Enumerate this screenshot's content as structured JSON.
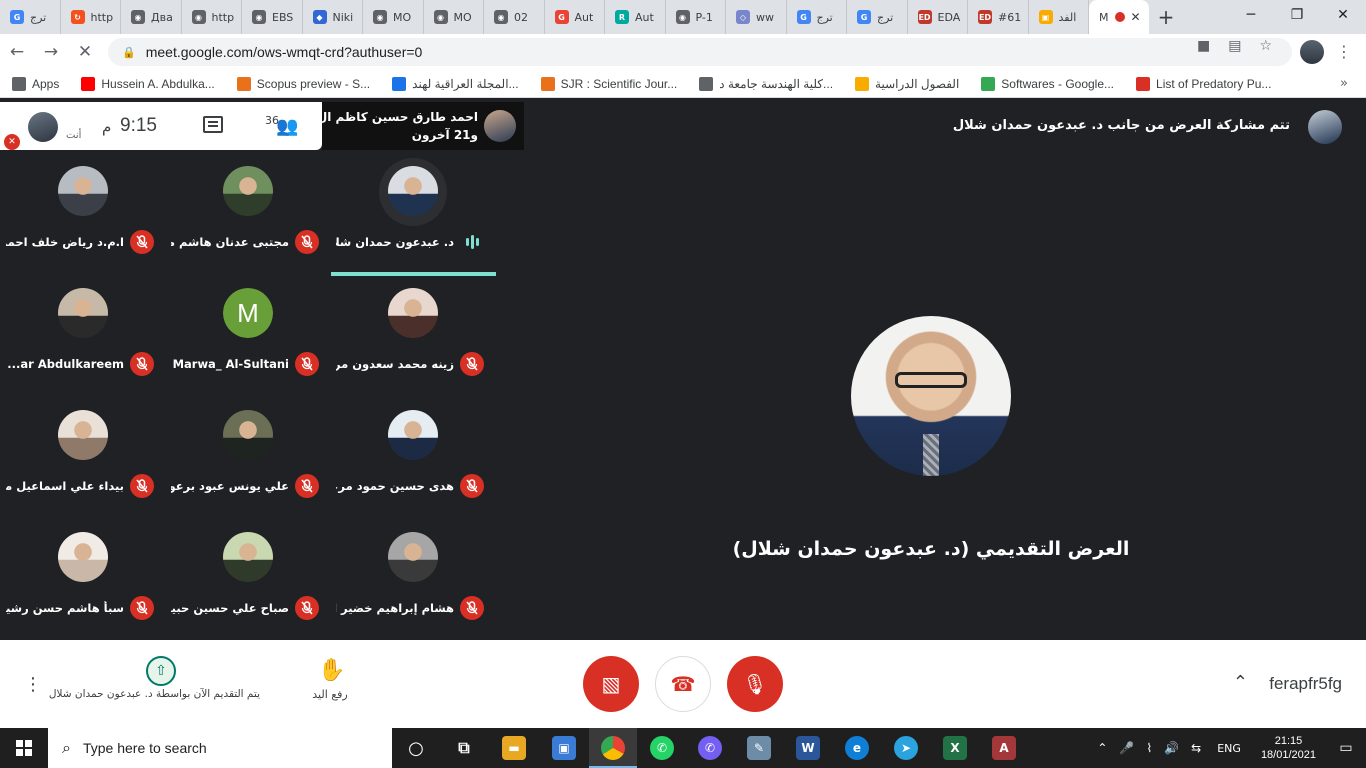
{
  "tabs": [
    {
      "label": "ترج",
      "color": "#4285f4",
      "glyph": "G"
    },
    {
      "label": "http",
      "color": "#f4511e",
      "glyph": "↻"
    },
    {
      "label": "Два",
      "color": "#5f6368",
      "glyph": "◉"
    },
    {
      "label": "http",
      "color": "#5f6368",
      "glyph": "◉"
    },
    {
      "label": "EBS",
      "color": "#5f6368",
      "glyph": "◉"
    },
    {
      "label": "Niki",
      "color": "#3367d6",
      "glyph": "◆"
    },
    {
      "label": "MO",
      "color": "#5f6368",
      "glyph": "◉"
    },
    {
      "label": "MO",
      "color": "#5f6368",
      "glyph": "◉"
    },
    {
      "label": "02",
      "color": "#5f6368",
      "glyph": "◉"
    },
    {
      "label": "Aut",
      "color": "#ea4335",
      "glyph": "G"
    },
    {
      "label": "Aut",
      "color": "#00a99d",
      "glyph": "R"
    },
    {
      "label": "P-1",
      "color": "#5f6368",
      "glyph": "◉"
    },
    {
      "label": "ww",
      "color": "#7986cb",
      "glyph": "◇"
    },
    {
      "label": "ترج",
      "color": "#4285f4",
      "glyph": "G"
    },
    {
      "label": "ترج",
      "color": "#4285f4",
      "glyph": "G"
    },
    {
      "label": "EDA",
      "color": "#c0392b",
      "glyph": "ED"
    },
    {
      "label": "#61",
      "color": "#c0392b",
      "glyph": "ED"
    },
    {
      "label": "الفد",
      "color": "#f9ab00",
      "glyph": "▣"
    }
  ],
  "active_tab": {
    "label": "M",
    "close": "✕"
  },
  "new_tab": "+",
  "window_controls": [
    "─",
    "❐",
    "✕"
  ],
  "address": {
    "url": "meet.google.com/ows-wmqt-crd?authuser=0"
  },
  "bookmarks": [
    {
      "label": "Apps",
      "color": "#5f6368"
    },
    {
      "label": "Hussein A. Abdulka...",
      "color": "#ff0000"
    },
    {
      "label": "Scopus preview - S...",
      "color": "#e9711c"
    },
    {
      "label": "المجلة العراقية لهند...",
      "color": "#1a73e8"
    },
    {
      "label": "SJR : Scientific Jour...",
      "color": "#e9711c"
    },
    {
      "label": "كلية الهندسة جامعة د...",
      "color": "#5f6368"
    },
    {
      "label": "الفصول الدراسية",
      "color": "#f9ab00"
    },
    {
      "label": "Softwares - Google...",
      "color": "#34a853"
    },
    {
      "label": "List of Predatory Pu...",
      "color": "#d93025"
    }
  ],
  "bookmarks_more": "»",
  "meet": {
    "self_label": "أنت",
    "clock_ampm": "م",
    "clock": "9:15",
    "participant_count": "36",
    "speaker_name": "احمد طارق حسين كاظم ال...",
    "speaker_others": "و21 آخرون",
    "presenter_banner": "تتم مشاركة العرض من جانب د. عبدعون حمدان شلال",
    "presentation_title": "العرض التقديمي (د. عبدعون حمدان شلال)"
  },
  "participants": [
    {
      "name": "د. عبدعون حمدان شلال",
      "speaking": true,
      "photo": [
        "#d9dde2",
        "#1f3350"
      ]
    },
    {
      "name": "مجتبى عدنان هاشم محم...",
      "speaking": false,
      "photo": [
        "#6f8f5e",
        "#2f3e2a"
      ]
    },
    {
      "name": "ا.م.د رياض خلف احمد ...",
      "speaking": false,
      "photo": [
        "#b7bcc2",
        "#3a3f48"
      ]
    },
    {
      "name": "زينه محمد سعدون مراد...",
      "speaking": false,
      "photo": [
        "#e8d7cf",
        "#4a2f2a"
      ]
    },
    {
      "name": "Marwa_ Al-Sultani",
      "speaking": false,
      "letter": "M"
    },
    {
      "name": "...ar Abdulkareem",
      "speaking": false,
      "photo": [
        "#c7b9a8",
        "#2a2a2a"
      ]
    },
    {
      "name": "هدى حسين حمود مرعي",
      "speaking": false,
      "photo": [
        "#e5ecf2",
        "#1d2a44"
      ]
    },
    {
      "name": "علي يونس عبود برعو...",
      "speaking": false,
      "photo": [
        "#6b6f55",
        "#1e2520"
      ]
    },
    {
      "name": "بيداء علي اسماعيل محم...",
      "speaking": false,
      "photo": [
        "#e9e1d8",
        "#8f7a6a"
      ]
    },
    {
      "name": "هشام إبراهيم خضير العـ...",
      "speaking": false,
      "photo": [
        "#a6a6a6",
        "#3a3a3a"
      ]
    },
    {
      "name": "صباح علي حسين حبيد...",
      "speaking": false,
      "photo": [
        "#c9d8b0",
        "#2f3a2a"
      ]
    },
    {
      "name": "سبأ هاشم حسن رشيد ال...",
      "speaking": false,
      "photo": [
        "#f1ebe6",
        "#c9b7a8"
      ]
    }
  ],
  "controls": {
    "present_now": "يتم التقديم الآن بواسطة د. عبدعون حمدان شلال",
    "raise_hand": "رفع اليد",
    "meeting_code": "ferapfr5fg"
  },
  "taskbar": {
    "search_placeholder": "Type here to search",
    "lang": "ENG",
    "time": "21:15",
    "date": "18/01/2021"
  },
  "colors": {
    "meet_bg": "#202124",
    "danger": "#d93025",
    "speaking_accent": "#80e0d0"
  }
}
